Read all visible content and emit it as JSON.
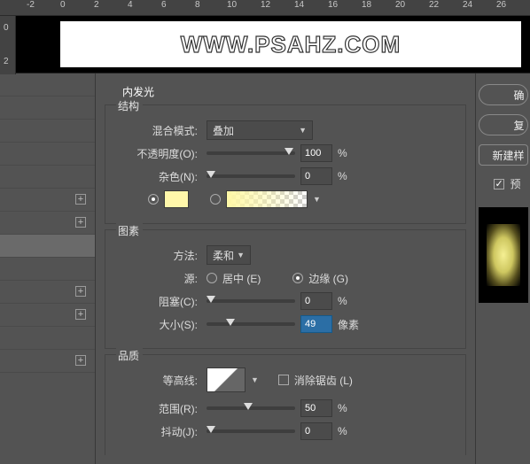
{
  "ruler_h": [
    "-2",
    "0",
    "2",
    "4",
    "6",
    "8",
    "10",
    "12",
    "14",
    "16",
    "18",
    "20",
    "22",
    "24",
    "26"
  ],
  "ruler_v": [
    "0",
    "2"
  ],
  "banner": {
    "text": "WWW.PSAHZ.COM"
  },
  "sections": {
    "inner_glow": "内发光",
    "structure": "结构",
    "elements": "图素",
    "quality": "品质"
  },
  "labels": {
    "blend": "混合模式:",
    "opacity": "不透明度(O):",
    "noise": "杂色(N):",
    "method": "方法:",
    "source": "源:",
    "center": "居中 (E)",
    "edge": "边缘 (G)",
    "choke": "阻塞(C):",
    "size": "大小(S):",
    "px": "像素",
    "contour": "等高线:",
    "anti": "消除锯齿 (L)",
    "range": "范围(R):",
    "jitter": "抖动(J):",
    "pct": "%"
  },
  "values": {
    "blend": "叠加",
    "opacity": "100",
    "noise": "0",
    "method": "柔和",
    "choke": "0",
    "size": "49",
    "range": "50",
    "jitter": "0"
  },
  "pos": {
    "opacity": 88,
    "noise": 0,
    "choke": 0,
    "size": 22,
    "range": 42,
    "jitter": 0
  },
  "right": {
    "ok": "确",
    "reset": "复",
    "new": "新建样",
    "preview": "预"
  }
}
